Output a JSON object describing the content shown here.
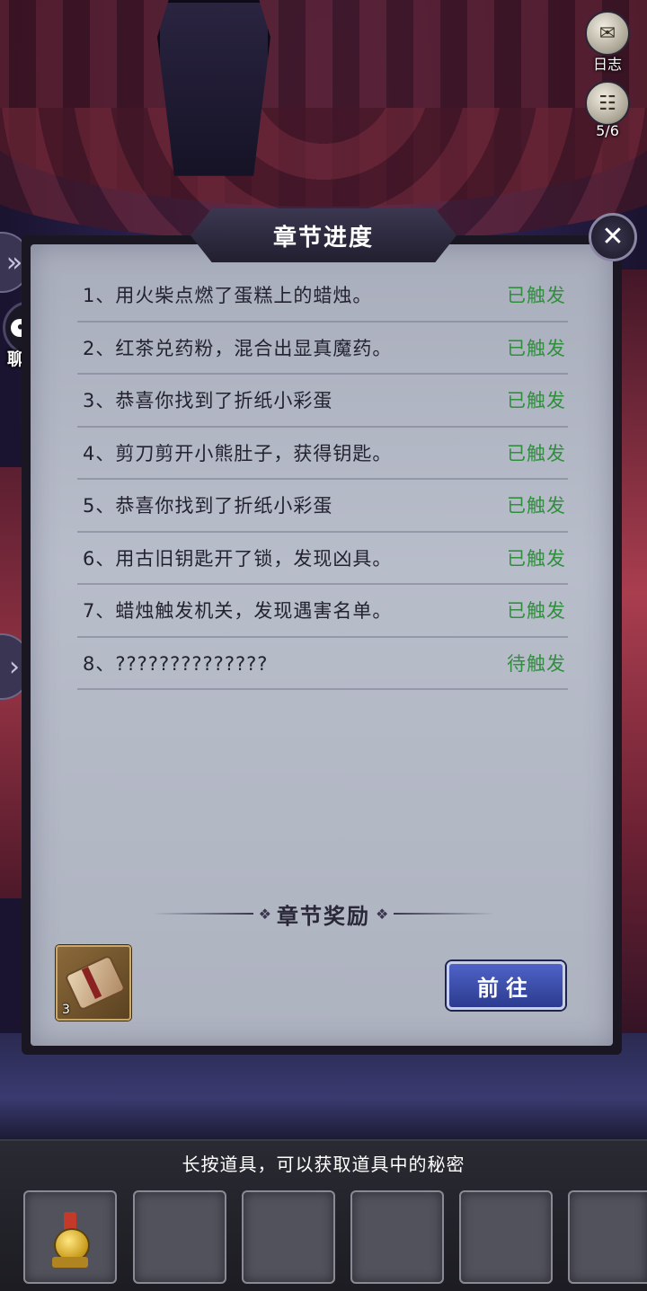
{
  "hud": {
    "journal_label": "日志",
    "pages_label": "5/6"
  },
  "side": {
    "chat_label": "聊天"
  },
  "panel": {
    "title": "章节进度",
    "rows": [
      {
        "text": "1、用火柴点燃了蛋糕上的蜡烛。",
        "status": "已触发"
      },
      {
        "text": "2、红茶兑药粉，混合出显真魔药。",
        "status": "已触发"
      },
      {
        "text": "3、恭喜你找到了折纸小彩蛋",
        "status": "已触发"
      },
      {
        "text": "4、剪刀剪开小熊肚子，获得钥匙。",
        "status": "已触发"
      },
      {
        "text": "5、恭喜你找到了折纸小彩蛋",
        "status": "已触发"
      },
      {
        "text": "6、用古旧钥匙开了锁，发现凶具。",
        "status": "已触发"
      },
      {
        "text": "7、蜡烛触发机关，发现遇害名单。",
        "status": "已触发"
      },
      {
        "text": "8、??????????????",
        "status": "待触发"
      }
    ],
    "reward_title": "章节奖励",
    "reward_item": {
      "icon": "scroll-icon",
      "count": "3"
    },
    "goto_label": "前往",
    "status_color": "#2f8f3c"
  },
  "inventory": {
    "hint": "长按道具，可以获取道具中的秘密",
    "slots": [
      {
        "icon": "potion-icon"
      },
      {
        "icon": ""
      },
      {
        "icon": ""
      },
      {
        "icon": ""
      },
      {
        "icon": ""
      },
      {
        "icon": ""
      }
    ]
  }
}
